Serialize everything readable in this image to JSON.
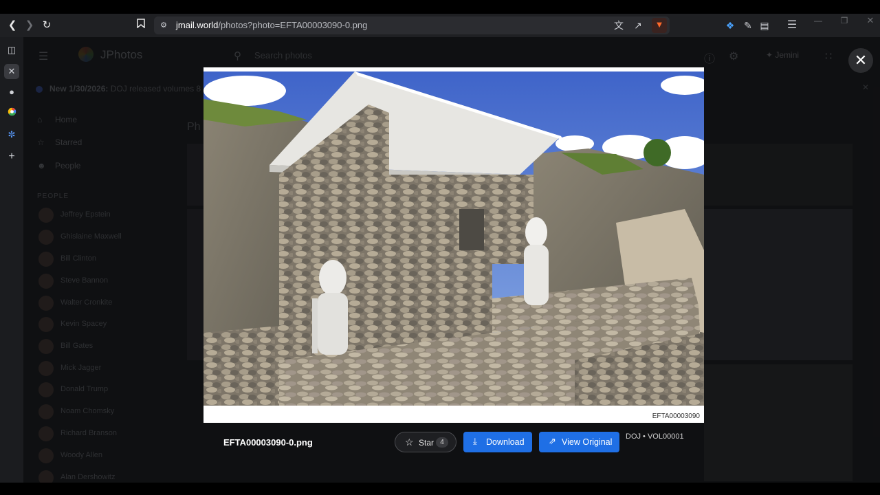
{
  "browser": {
    "url_domain": "jmail.world",
    "url_path": "/photos?photo=EFTA00003090-0.png",
    "icons": [
      "back-icon",
      "forward-icon",
      "reload-icon",
      "bookmark-icon",
      "site-settings-icon",
      "translate-icon",
      "share-icon",
      "brave-shield-icon",
      "leo-icon",
      "extensions-icon",
      "wallet-icon",
      "menu-icon"
    ]
  },
  "side_rail": {
    "icons": [
      "sidebar-toggle-icon",
      "close-tab-icon",
      "globe-icon",
      "google-icon",
      "tab-icon",
      "add-icon"
    ]
  },
  "app": {
    "title": "JPhotos",
    "search_placeholder": "Search photos",
    "user_label": "Jemini",
    "notice_title": "New 1/30/2026:",
    "notice_text": "DOJ released volumes 8",
    "nav": [
      {
        "label": "Home",
        "icon": "home-icon"
      },
      {
        "label": "Starred",
        "icon": "star-icon"
      },
      {
        "label": "People",
        "icon": "people-icon"
      }
    ],
    "people_header": "PEOPLE",
    "people": [
      "Jeffrey Epstein",
      "Ghislaine Maxwell",
      "Bill Clinton",
      "Steve Bannon",
      "Walter Cronkite",
      "Kevin Spacey",
      "Bill Gates",
      "Mick Jagger",
      "Donald Trump",
      "Noam Chomsky",
      "Richard Branson",
      "Woody Allen",
      "Alan Dershowitz"
    ],
    "section_title": "Ph"
  },
  "lightbox": {
    "photo_id_label": "EFTA00003090",
    "filename": "EFTA00003090-0.png",
    "star_label": "Star",
    "star_count": "4",
    "download_label": "Download",
    "view_original_label": "View Original",
    "source_meta": "DOJ • VOL00001",
    "colors": {
      "accent": "#1f6fe5",
      "overlay": "#000000"
    }
  }
}
